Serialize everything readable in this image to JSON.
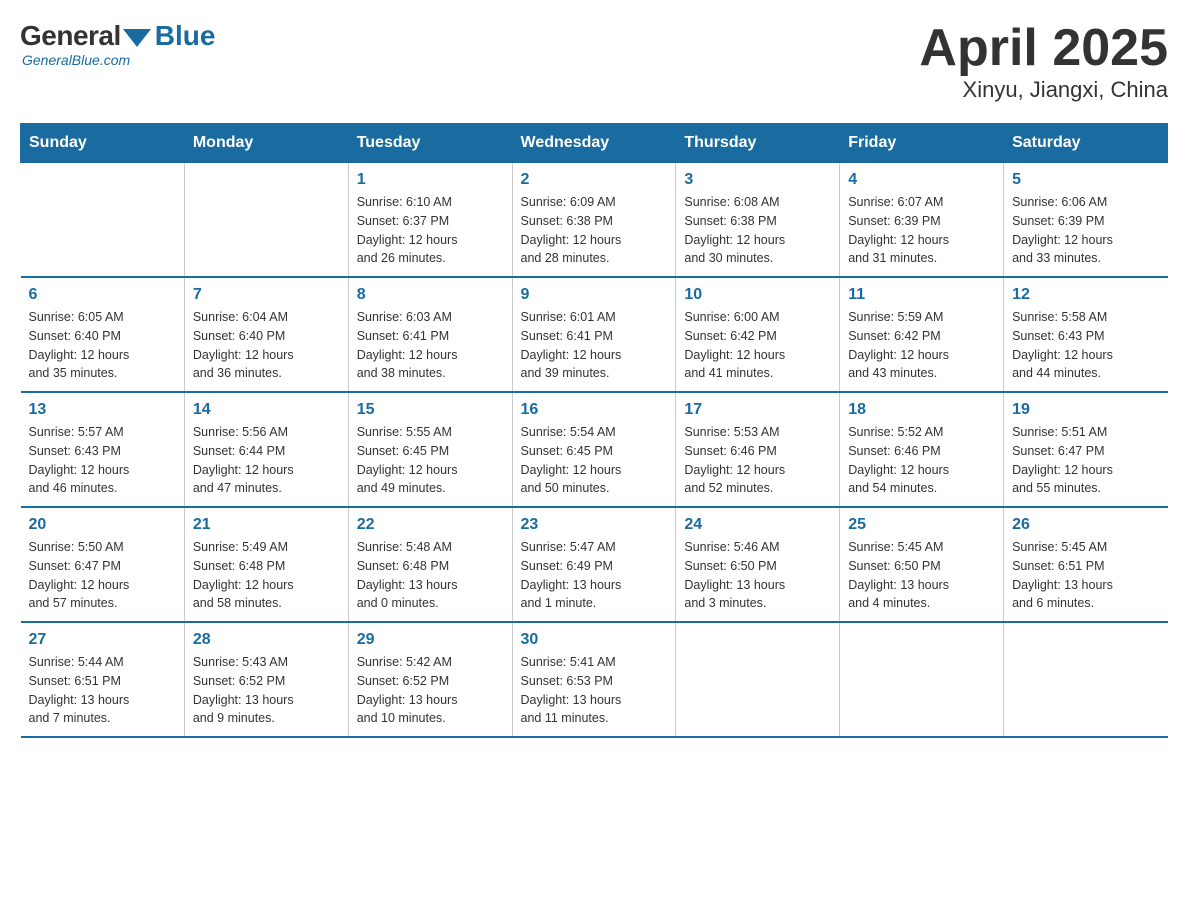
{
  "logo": {
    "general": "General",
    "blue": "Blue",
    "tagline": "GeneralBlue.com"
  },
  "title": "April 2025",
  "subtitle": "Xinyu, Jiangxi, China",
  "headers": [
    "Sunday",
    "Monday",
    "Tuesday",
    "Wednesday",
    "Thursday",
    "Friday",
    "Saturday"
  ],
  "weeks": [
    [
      {
        "day": "",
        "info": ""
      },
      {
        "day": "",
        "info": ""
      },
      {
        "day": "1",
        "info": "Sunrise: 6:10 AM\nSunset: 6:37 PM\nDaylight: 12 hours\nand 26 minutes."
      },
      {
        "day": "2",
        "info": "Sunrise: 6:09 AM\nSunset: 6:38 PM\nDaylight: 12 hours\nand 28 minutes."
      },
      {
        "day": "3",
        "info": "Sunrise: 6:08 AM\nSunset: 6:38 PM\nDaylight: 12 hours\nand 30 minutes."
      },
      {
        "day": "4",
        "info": "Sunrise: 6:07 AM\nSunset: 6:39 PM\nDaylight: 12 hours\nand 31 minutes."
      },
      {
        "day": "5",
        "info": "Sunrise: 6:06 AM\nSunset: 6:39 PM\nDaylight: 12 hours\nand 33 minutes."
      }
    ],
    [
      {
        "day": "6",
        "info": "Sunrise: 6:05 AM\nSunset: 6:40 PM\nDaylight: 12 hours\nand 35 minutes."
      },
      {
        "day": "7",
        "info": "Sunrise: 6:04 AM\nSunset: 6:40 PM\nDaylight: 12 hours\nand 36 minutes."
      },
      {
        "day": "8",
        "info": "Sunrise: 6:03 AM\nSunset: 6:41 PM\nDaylight: 12 hours\nand 38 minutes."
      },
      {
        "day": "9",
        "info": "Sunrise: 6:01 AM\nSunset: 6:41 PM\nDaylight: 12 hours\nand 39 minutes."
      },
      {
        "day": "10",
        "info": "Sunrise: 6:00 AM\nSunset: 6:42 PM\nDaylight: 12 hours\nand 41 minutes."
      },
      {
        "day": "11",
        "info": "Sunrise: 5:59 AM\nSunset: 6:42 PM\nDaylight: 12 hours\nand 43 minutes."
      },
      {
        "day": "12",
        "info": "Sunrise: 5:58 AM\nSunset: 6:43 PM\nDaylight: 12 hours\nand 44 minutes."
      }
    ],
    [
      {
        "day": "13",
        "info": "Sunrise: 5:57 AM\nSunset: 6:43 PM\nDaylight: 12 hours\nand 46 minutes."
      },
      {
        "day": "14",
        "info": "Sunrise: 5:56 AM\nSunset: 6:44 PM\nDaylight: 12 hours\nand 47 minutes."
      },
      {
        "day": "15",
        "info": "Sunrise: 5:55 AM\nSunset: 6:45 PM\nDaylight: 12 hours\nand 49 minutes."
      },
      {
        "day": "16",
        "info": "Sunrise: 5:54 AM\nSunset: 6:45 PM\nDaylight: 12 hours\nand 50 minutes."
      },
      {
        "day": "17",
        "info": "Sunrise: 5:53 AM\nSunset: 6:46 PM\nDaylight: 12 hours\nand 52 minutes."
      },
      {
        "day": "18",
        "info": "Sunrise: 5:52 AM\nSunset: 6:46 PM\nDaylight: 12 hours\nand 54 minutes."
      },
      {
        "day": "19",
        "info": "Sunrise: 5:51 AM\nSunset: 6:47 PM\nDaylight: 12 hours\nand 55 minutes."
      }
    ],
    [
      {
        "day": "20",
        "info": "Sunrise: 5:50 AM\nSunset: 6:47 PM\nDaylight: 12 hours\nand 57 minutes."
      },
      {
        "day": "21",
        "info": "Sunrise: 5:49 AM\nSunset: 6:48 PM\nDaylight: 12 hours\nand 58 minutes."
      },
      {
        "day": "22",
        "info": "Sunrise: 5:48 AM\nSunset: 6:48 PM\nDaylight: 13 hours\nand 0 minutes."
      },
      {
        "day": "23",
        "info": "Sunrise: 5:47 AM\nSunset: 6:49 PM\nDaylight: 13 hours\nand 1 minute."
      },
      {
        "day": "24",
        "info": "Sunrise: 5:46 AM\nSunset: 6:50 PM\nDaylight: 13 hours\nand 3 minutes."
      },
      {
        "day": "25",
        "info": "Sunrise: 5:45 AM\nSunset: 6:50 PM\nDaylight: 13 hours\nand 4 minutes."
      },
      {
        "day": "26",
        "info": "Sunrise: 5:45 AM\nSunset: 6:51 PM\nDaylight: 13 hours\nand 6 minutes."
      }
    ],
    [
      {
        "day": "27",
        "info": "Sunrise: 5:44 AM\nSunset: 6:51 PM\nDaylight: 13 hours\nand 7 minutes."
      },
      {
        "day": "28",
        "info": "Sunrise: 5:43 AM\nSunset: 6:52 PM\nDaylight: 13 hours\nand 9 minutes."
      },
      {
        "day": "29",
        "info": "Sunrise: 5:42 AM\nSunset: 6:52 PM\nDaylight: 13 hours\nand 10 minutes."
      },
      {
        "day": "30",
        "info": "Sunrise: 5:41 AM\nSunset: 6:53 PM\nDaylight: 13 hours\nand 11 minutes."
      },
      {
        "day": "",
        "info": ""
      },
      {
        "day": "",
        "info": ""
      },
      {
        "day": "",
        "info": ""
      }
    ]
  ]
}
